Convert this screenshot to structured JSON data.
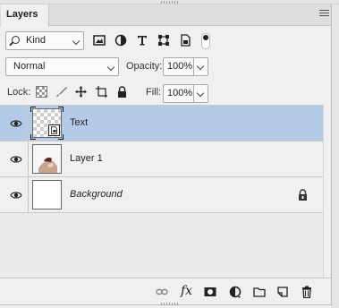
{
  "panel": {
    "tab_label": "Layers"
  },
  "filter": {
    "kind_label": "Kind",
    "icons": [
      "image-filter-icon",
      "adjustment-filter-icon",
      "type-filter-icon",
      "shape-filter-icon",
      "smart-object-filter-icon"
    ]
  },
  "blend": {
    "mode": "Normal",
    "opacity_label": "Opacity:",
    "opacity_value": "100%"
  },
  "lock": {
    "label": "Lock:",
    "fill_label": "Fill:",
    "fill_value": "100%",
    "icons": [
      "lock-transparent-pixels-icon",
      "lock-image-pixels-icon",
      "lock-position-icon",
      "lock-artboard-icon",
      "lock-all-icon"
    ]
  },
  "layers": [
    {
      "name": "Text",
      "selected": true,
      "italic": false,
      "locked": false,
      "thumb": "checker-smart"
    },
    {
      "name": "Layer 1",
      "selected": false,
      "italic": false,
      "locked": false,
      "thumb": "photo"
    },
    {
      "name": "Background",
      "selected": false,
      "italic": true,
      "locked": true,
      "thumb": "white"
    }
  ],
  "footer": {
    "icons": [
      "link-layers-icon",
      "fx-icon",
      "add-mask-icon",
      "new-adjustment-layer-icon",
      "new-group-icon",
      "new-layer-icon",
      "delete-layer-icon"
    ],
    "fx_label": "fx"
  },
  "colors": {
    "panel_bg": "#f0f0f0",
    "selected_row": "#b4cbe8",
    "tab_bar": "#dedede"
  }
}
